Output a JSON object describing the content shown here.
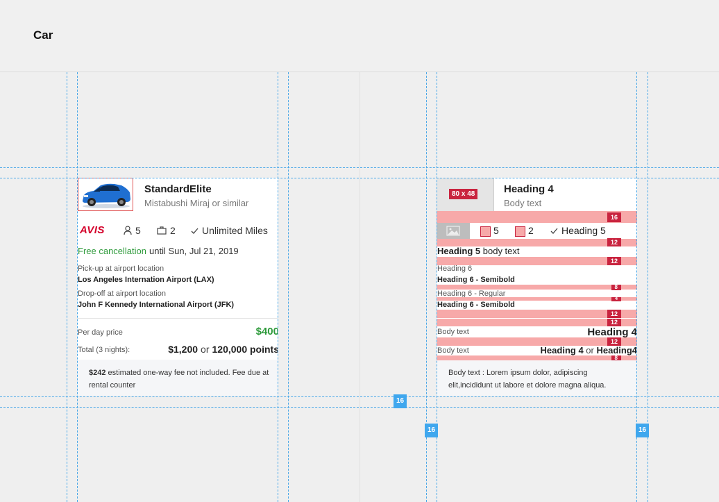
{
  "page": {
    "title": "Car"
  },
  "left_card": {
    "car_name": "StandardElite",
    "car_sub": "Mistabushi Miraj or similar",
    "vendor_logo_text": "AVIS",
    "passengers": "5",
    "bags": "2",
    "mileage": "Unlimited Miles",
    "free_cancel": "Free cancellation",
    "until": "until Sun, Jul 21, 2019",
    "pickup_label": "Pick-up at airport location",
    "pickup_value": "Los Angeles Internation Airport (LAX)",
    "dropoff_label": "Drop-off at airport location",
    "dropoff_value": "John F Kennedy International Airport (JFK)",
    "per_day_label": "Per day price",
    "per_day_value": "$400",
    "total_label": "Total (3 nights):",
    "total_price": "$1,200",
    "or": "or",
    "total_points": "120,000 points",
    "fee_amount": "$242",
    "fee_text": "estimated one-way fee not included. Fee due at rental counter"
  },
  "right_card": {
    "img_label": "80 x 48",
    "heading4": "Heading 4",
    "body_text": "Body text",
    "spacing_16": "16",
    "spacing_12": "12",
    "spacing_8": "8",
    "spacing_4": "4",
    "passengers": "5",
    "bags": "2",
    "heading5": "Heading 5",
    "h5_body_head": "Heading 5",
    "h5_body_rest": "body text",
    "heading6": "Heading 6",
    "heading6_semibold": "Heading 6 - Semibold",
    "heading6_regular": "Heading 6 - Regular",
    "row1_left": "Body text",
    "row1_right": "Heading 4",
    "row2_left": "Body text",
    "row2_right_a": "Heading 4",
    "row2_or": "or",
    "row2_right_b": "Heading4",
    "lorem": "Body text : Lorem ipsum dolor, adipiscing elit,incididunt ut labore et dolore magna aliqua."
  },
  "guides": {
    "bottom_gap": "16",
    "left_gutter": "16",
    "right_gutter": "16"
  },
  "colors": {
    "accent_green": "#2e9a3b",
    "avis_red": "#d4002a",
    "spec_pink": "#f7a9a9",
    "spec_red": "#c9243f",
    "guide_blue": "#4aa8e8"
  }
}
